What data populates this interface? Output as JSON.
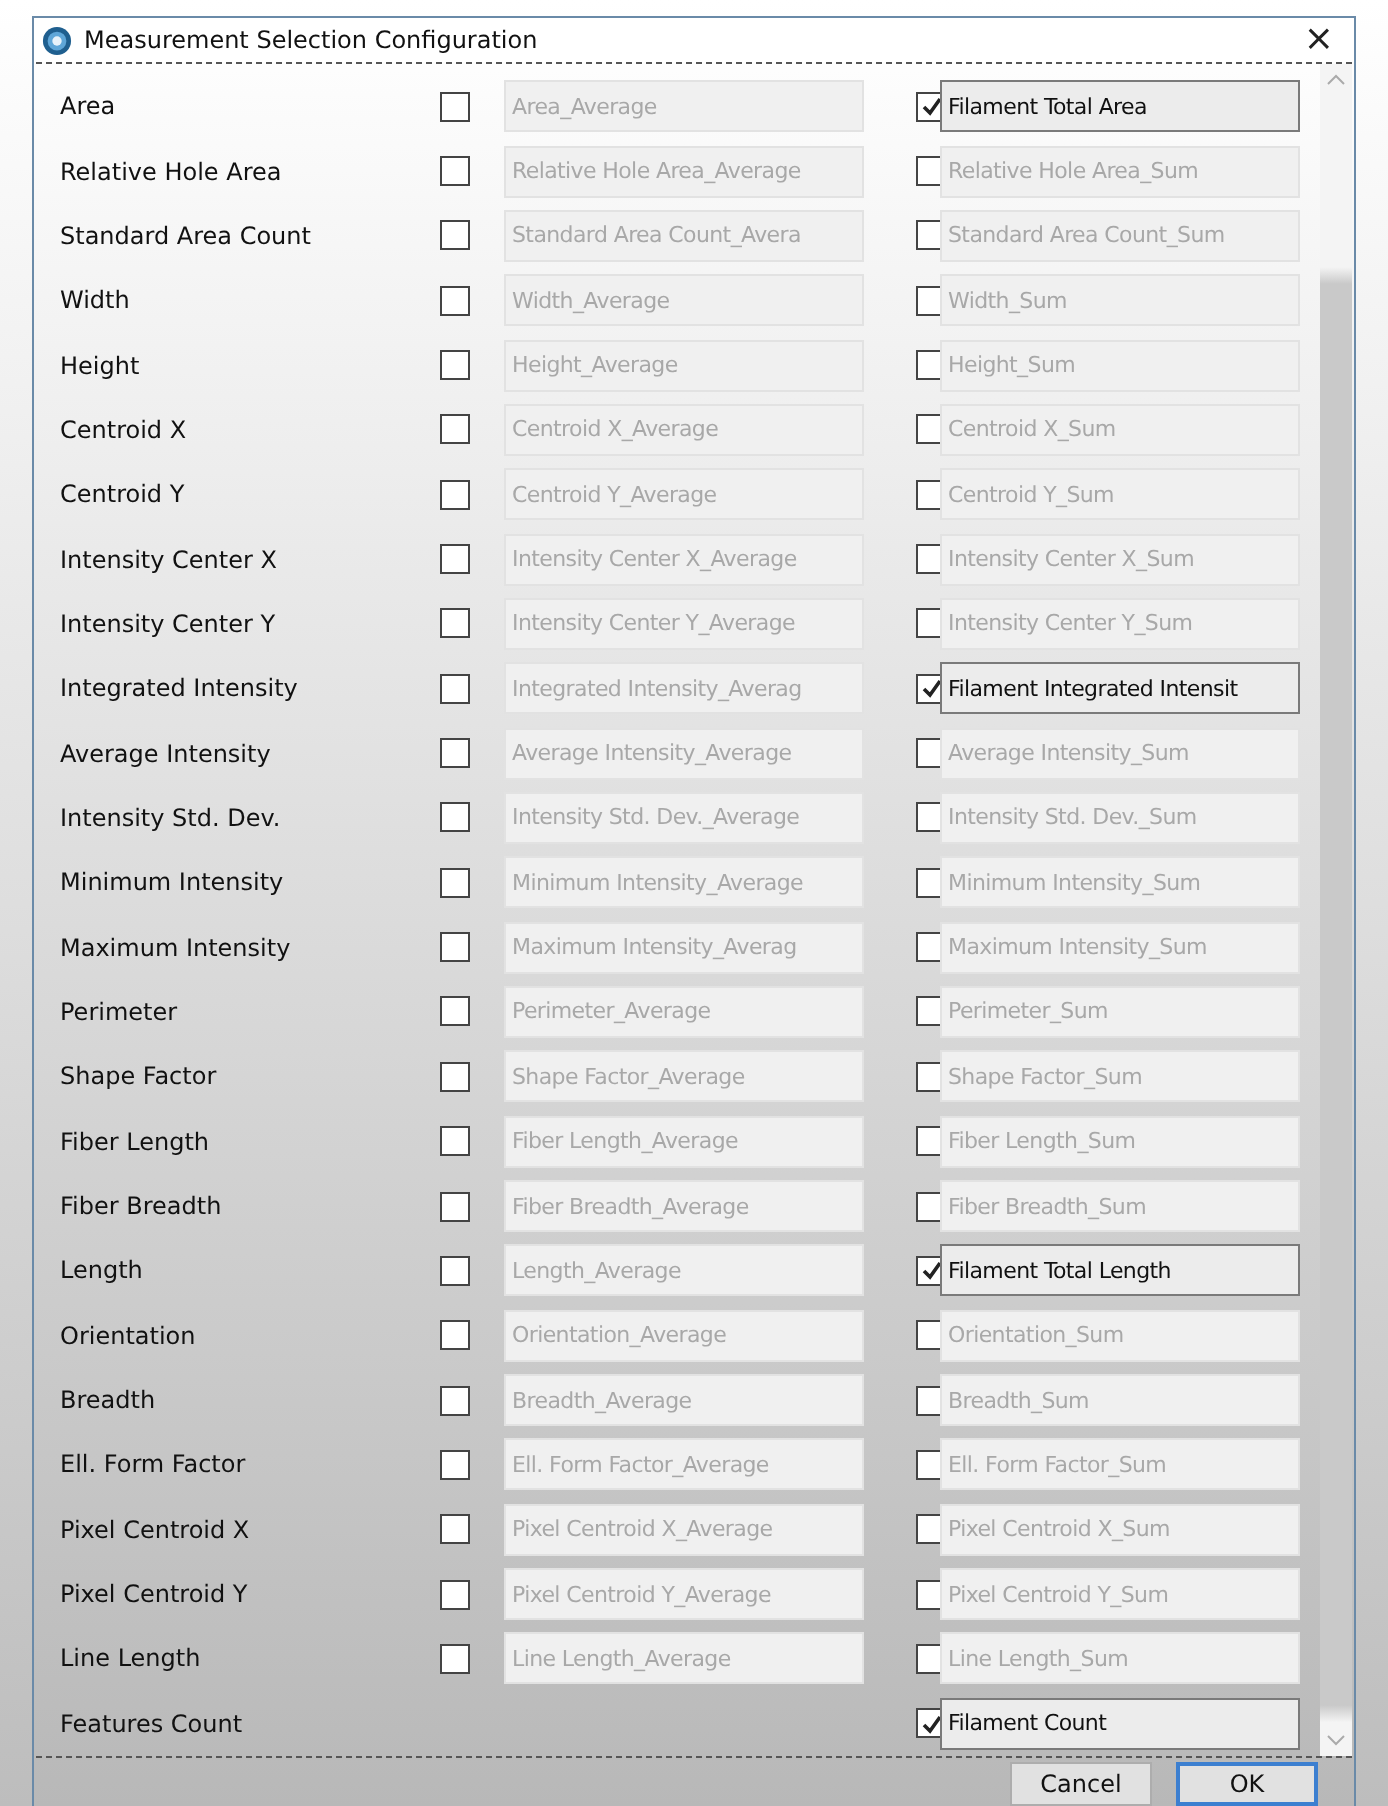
{
  "window": {
    "title": "Measurement Selection Configuration",
    "close": "×"
  },
  "rows": [
    {
      "label": "Area",
      "average": {
        "checked": false,
        "value": "Area_Average"
      },
      "sum": {
        "checked": true,
        "value": "Filament Total Area"
      }
    },
    {
      "label": "Relative Hole Area",
      "average": {
        "checked": false,
        "value": "Relative Hole Area_Average"
      },
      "sum": {
        "checked": false,
        "value": "Relative Hole Area_Sum"
      }
    },
    {
      "label": "Standard Area Count",
      "average": {
        "checked": false,
        "value": "Standard Area Count_Avera"
      },
      "sum": {
        "checked": false,
        "value": "Standard Area Count_Sum"
      }
    },
    {
      "label": "Width",
      "average": {
        "checked": false,
        "value": "Width_Average"
      },
      "sum": {
        "checked": false,
        "value": "Width_Sum"
      }
    },
    {
      "label": "Height",
      "average": {
        "checked": false,
        "value": "Height_Average"
      },
      "sum": {
        "checked": false,
        "value": "Height_Sum"
      }
    },
    {
      "label": "Centroid X",
      "average": {
        "checked": false,
        "value": "Centroid X_Average"
      },
      "sum": {
        "checked": false,
        "value": "Centroid X_Sum"
      }
    },
    {
      "label": "Centroid Y",
      "average": {
        "checked": false,
        "value": "Centroid Y_Average"
      },
      "sum": {
        "checked": false,
        "value": "Centroid Y_Sum"
      }
    },
    {
      "label": "Intensity Center X",
      "average": {
        "checked": false,
        "value": "Intensity Center X_Average"
      },
      "sum": {
        "checked": false,
        "value": "Intensity Center X_Sum"
      }
    },
    {
      "label": "Intensity Center Y",
      "average": {
        "checked": false,
        "value": "Intensity Center Y_Average"
      },
      "sum": {
        "checked": false,
        "value": "Intensity Center Y_Sum"
      }
    },
    {
      "label": "Integrated Intensity",
      "average": {
        "checked": false,
        "value": "Integrated Intensity_Averag"
      },
      "sum": {
        "checked": true,
        "value": "Filament Integrated Intensit"
      }
    },
    {
      "label": "Average Intensity",
      "average": {
        "checked": false,
        "value": "Average Intensity_Average"
      },
      "sum": {
        "checked": false,
        "value": "Average Intensity_Sum"
      }
    },
    {
      "label": "Intensity Std. Dev.",
      "average": {
        "checked": false,
        "value": "Intensity Std. Dev._Average"
      },
      "sum": {
        "checked": false,
        "value": "Intensity Std. Dev._Sum"
      }
    },
    {
      "label": "Minimum Intensity",
      "average": {
        "checked": false,
        "value": "Minimum Intensity_Average"
      },
      "sum": {
        "checked": false,
        "value": "Minimum Intensity_Sum"
      }
    },
    {
      "label": "Maximum Intensity",
      "average": {
        "checked": false,
        "value": "Maximum Intensity_Averag"
      },
      "sum": {
        "checked": false,
        "value": "Maximum Intensity_Sum"
      }
    },
    {
      "label": "Perimeter",
      "average": {
        "checked": false,
        "value": "Perimeter_Average"
      },
      "sum": {
        "checked": false,
        "value": "Perimeter_Sum"
      }
    },
    {
      "label": "Shape Factor",
      "average": {
        "checked": false,
        "value": "Shape Factor_Average"
      },
      "sum": {
        "checked": false,
        "value": "Shape Factor_Sum"
      }
    },
    {
      "label": "Fiber Length",
      "average": {
        "checked": false,
        "value": "Fiber Length_Average"
      },
      "sum": {
        "checked": false,
        "value": "Fiber Length_Sum"
      }
    },
    {
      "label": "Fiber Breadth",
      "average": {
        "checked": false,
        "value": "Fiber Breadth_Average"
      },
      "sum": {
        "checked": false,
        "value": "Fiber Breadth_Sum"
      }
    },
    {
      "label": "Length",
      "average": {
        "checked": false,
        "value": "Length_Average"
      },
      "sum": {
        "checked": true,
        "value": "Filament Total Length"
      }
    },
    {
      "label": "Orientation",
      "average": {
        "checked": false,
        "value": "Orientation_Average"
      },
      "sum": {
        "checked": false,
        "value": "Orientation_Sum"
      }
    },
    {
      "label": "Breadth",
      "average": {
        "checked": false,
        "value": "Breadth_Average"
      },
      "sum": {
        "checked": false,
        "value": "Breadth_Sum"
      }
    },
    {
      "label": "Ell. Form Factor",
      "average": {
        "checked": false,
        "value": "Ell. Form Factor_Average"
      },
      "sum": {
        "checked": false,
        "value": "Ell. Form Factor_Sum"
      }
    },
    {
      "label": "Pixel Centroid X",
      "average": {
        "checked": false,
        "value": "Pixel Centroid X_Average"
      },
      "sum": {
        "checked": false,
        "value": "Pixel Centroid X_Sum"
      }
    },
    {
      "label": "Pixel Centroid Y",
      "average": {
        "checked": false,
        "value": "Pixel Centroid Y_Average"
      },
      "sum": {
        "checked": false,
        "value": "Pixel Centroid Y_Sum"
      }
    },
    {
      "label": "Line Length",
      "average": {
        "checked": false,
        "value": "Line Length_Average"
      },
      "sum": {
        "checked": false,
        "value": "Line Length_Sum"
      }
    },
    {
      "label": "Features Count",
      "sum": {
        "checked": true,
        "value": "Filament Count"
      }
    }
  ],
  "buttons": [
    "Cancel",
    "OK"
  ]
}
